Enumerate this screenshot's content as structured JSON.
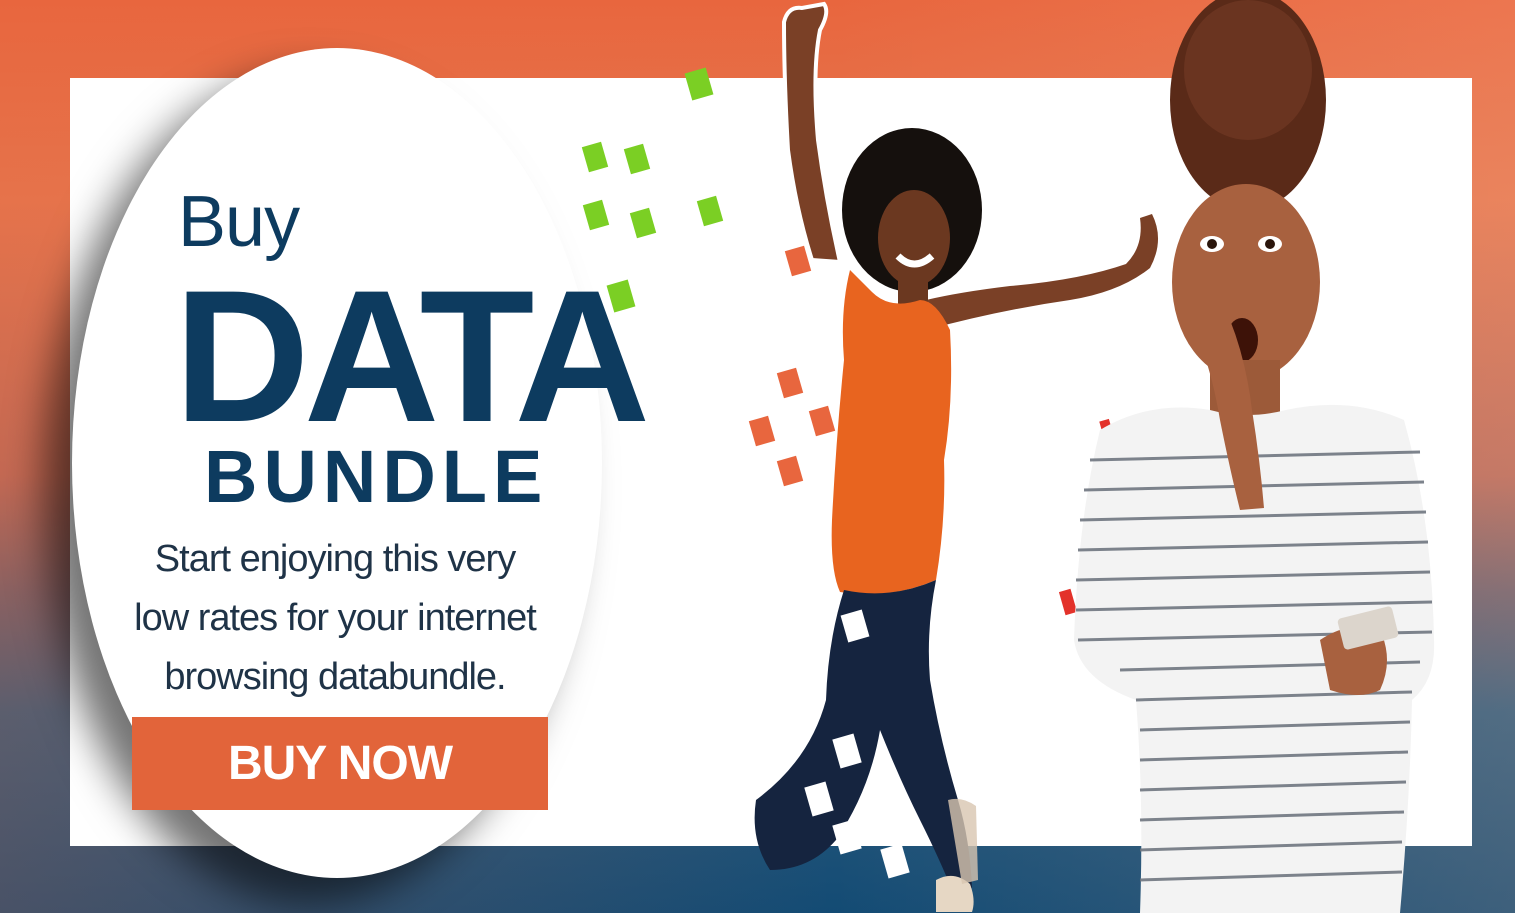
{
  "banner": {
    "headline_buy": "Buy",
    "headline_data": "DATA",
    "headline_bundle": "BUNDLE",
    "subtext_lines": [
      "Start enjoying this very",
      "low rates for your internet",
      "browsing databundle."
    ],
    "cta_label": "BUY NOW"
  },
  "colors": {
    "navy": "#0d3b5f",
    "accent_orange": "#e2643a",
    "green_squares": "#7bcf24",
    "background_top": "#e8663e",
    "background_bottom": "#134b74"
  },
  "images": [
    "jumping-woman-orange-top",
    "surprised-woman-striped-shirt-with-phone"
  ]
}
